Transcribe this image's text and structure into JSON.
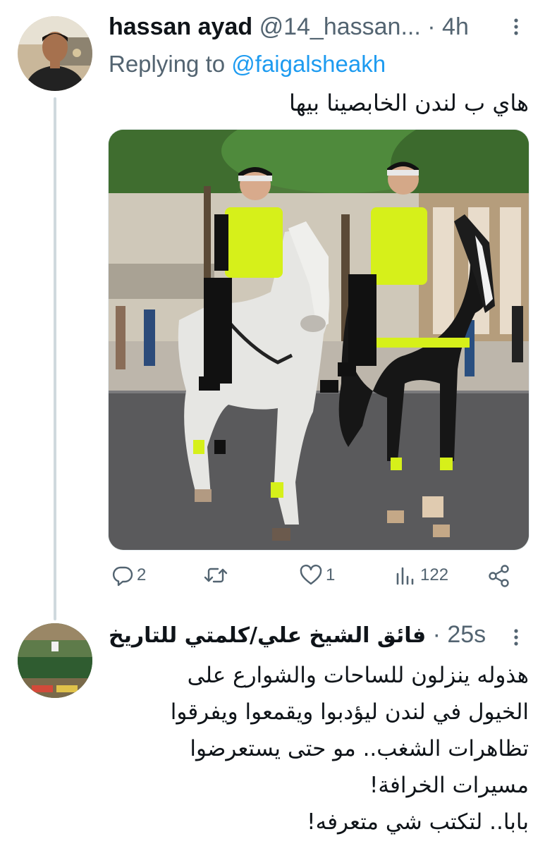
{
  "tweet1": {
    "author_name": "hassan ayad",
    "author_handle": "@14_hassan...",
    "separator": "·",
    "time": "4h",
    "replying_label": "Replying to",
    "replying_mention": "@faigalsheakh",
    "text": "هاي ب لندن الخابصينا بيها",
    "image_icon": "photo-mounted-police",
    "actions": {
      "replies": "2",
      "retweets": "",
      "likes": "1",
      "views": "122"
    }
  },
  "tweet2": {
    "author_name": "فائق الشيخ علي/كلمتي للتاريخ",
    "separator": "·",
    "time": "25s",
    "lines": [
      "هذوله ينزلون للساحات والشوارع على",
      "الخيول في لندن ليؤدبوا ويقمعوا ويفرقوا",
      "تظاهرات الشغب.. مو حتى يستعرضوا",
      "مسيرات الخرافة!",
      "بابا.. لتكتب شي متعرفه!"
    ]
  },
  "colors": {
    "accent": "#1d9bf0",
    "secondary_text": "#536471",
    "thread_line": "#cfd9de"
  }
}
